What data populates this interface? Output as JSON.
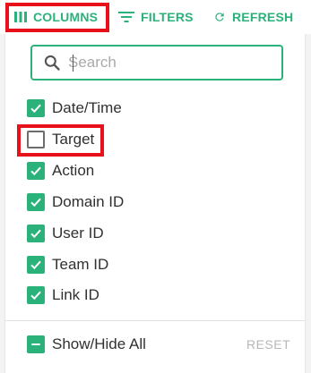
{
  "toolbar": {
    "columns_label": "COLUMNS",
    "filters_label": "FILTERS",
    "refresh_label": "REFRESH",
    "columns_icon": "columns-icon",
    "filters_icon": "filter-lines-icon",
    "refresh_icon": "refresh-icon"
  },
  "columns_panel": {
    "search": {
      "value": "",
      "placeholder": "Search",
      "icon": "search-icon"
    },
    "items": [
      {
        "label": "Date/Time",
        "checked": true
      },
      {
        "label": "Target",
        "checked": false
      },
      {
        "label": "Action",
        "checked": true
      },
      {
        "label": "Domain ID",
        "checked": true
      },
      {
        "label": "User ID",
        "checked": true
      },
      {
        "label": "Team ID",
        "checked": true
      },
      {
        "label": "Link ID",
        "checked": true
      }
    ],
    "footer": {
      "toggle_label": "Show/Hide All",
      "toggle_state": "indeterminate",
      "reset_label": "RESET",
      "reset_enabled": false
    }
  },
  "colors": {
    "accent": "#2bb27a",
    "highlight": "#e8101a",
    "text": "#303030",
    "disabled_text": "#b7b7b7"
  }
}
